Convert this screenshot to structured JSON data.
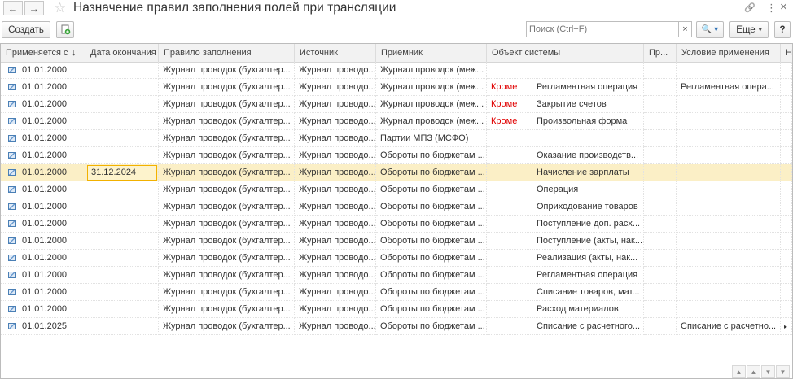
{
  "window": {
    "title": "Назначение правил заполнения полей при трансляции",
    "back_icon": "←",
    "forward_icon": "→",
    "star_icon": "☆",
    "link_icon": "🔗",
    "more_icon": "⋮",
    "close_icon": "×"
  },
  "toolbar": {
    "create_label": "Создать",
    "search_placeholder": "Поиск (Ctrl+F)",
    "clear_icon": "×",
    "search_button_icon": "🔍 ▾",
    "more_label": "Еще",
    "more_arrow": "▾",
    "help_label": "?"
  },
  "table": {
    "headers": [
      "Применяется с",
      "Дата окончания",
      "Правило заполнения",
      "Источник",
      "Приемник",
      "Объект системы",
      "Пр...",
      "Условие применения",
      "Н"
    ],
    "sort_indicator": "↓",
    "rows": [
      {
        "start": "01.01.2000",
        "end": "",
        "rule": "Журнал проводок (бухгалтер...",
        "source": "Журнал проводо...",
        "dest": "Журнал проводок (меж...",
        "except": "",
        "object": "",
        "pr": "",
        "condition": ""
      },
      {
        "start": "01.01.2000",
        "end": "",
        "rule": "Журнал проводок (бухгалтер...",
        "source": "Журнал проводо...",
        "dest": "Журнал проводок (меж...",
        "except": "Кроме",
        "object": "Регламентная операция",
        "pr": "",
        "condition": "Регламентная опера..."
      },
      {
        "start": "01.01.2000",
        "end": "",
        "rule": "Журнал проводок (бухгалтер...",
        "source": "Журнал проводо...",
        "dest": "Журнал проводок (меж...",
        "except": "Кроме",
        "object": "Закрытие счетов",
        "pr": "",
        "condition": ""
      },
      {
        "start": "01.01.2000",
        "end": "",
        "rule": "Журнал проводок (бухгалтер...",
        "source": "Журнал проводо...",
        "dest": "Журнал проводок (меж...",
        "except": "Кроме",
        "object": "Произвольная форма",
        "pr": "",
        "condition": ""
      },
      {
        "start": "01.01.2000",
        "end": "",
        "rule": "Журнал проводок (бухгалтер...",
        "source": "Журнал проводо...",
        "dest": "Партии МПЗ (МСФО)",
        "except": "",
        "object": "",
        "pr": "",
        "condition": ""
      },
      {
        "start": "01.01.2000",
        "end": "",
        "rule": "Журнал проводок (бухгалтер...",
        "source": "Журнал проводо...",
        "dest": "Обороты по бюджетам ...",
        "except": "",
        "object": "Оказание производств...",
        "pr": "",
        "condition": ""
      },
      {
        "start": "01.01.2000",
        "end": "31.12.2024",
        "rule": "Журнал проводок (бухгалтер...",
        "source": "Журнал проводо...",
        "dest": "Обороты по бюджетам ...",
        "except": "",
        "object": "Начисление зарплаты",
        "pr": "",
        "condition": ""
      },
      {
        "start": "01.01.2000",
        "end": "",
        "rule": "Журнал проводок (бухгалтер...",
        "source": "Журнал проводо...",
        "dest": "Обороты по бюджетам ...",
        "except": "",
        "object": "Операция",
        "pr": "",
        "condition": ""
      },
      {
        "start": "01.01.2000",
        "end": "",
        "rule": "Журнал проводок (бухгалтер...",
        "source": "Журнал проводо...",
        "dest": "Обороты по бюджетам ...",
        "except": "",
        "object": "Оприходование товаров",
        "pr": "",
        "condition": ""
      },
      {
        "start": "01.01.2000",
        "end": "",
        "rule": "Журнал проводок (бухгалтер...",
        "source": "Журнал проводо...",
        "dest": "Обороты по бюджетам ...",
        "except": "",
        "object": "Поступление доп. расх...",
        "pr": "",
        "condition": ""
      },
      {
        "start": "01.01.2000",
        "end": "",
        "rule": "Журнал проводок (бухгалтер...",
        "source": "Журнал проводо...",
        "dest": "Обороты по бюджетам ...",
        "except": "",
        "object": "Поступление (акты, нак...",
        "pr": "",
        "condition": ""
      },
      {
        "start": "01.01.2000",
        "end": "",
        "rule": "Журнал проводок (бухгалтер...",
        "source": "Журнал проводо...",
        "dest": "Обороты по бюджетам ...",
        "except": "",
        "object": "Реализация (акты, нак...",
        "pr": "",
        "condition": ""
      },
      {
        "start": "01.01.2000",
        "end": "",
        "rule": "Журнал проводок (бухгалтер...",
        "source": "Журнал проводо...",
        "dest": "Обороты по бюджетам ...",
        "except": "",
        "object": "Регламентная операция",
        "pr": "",
        "condition": ""
      },
      {
        "start": "01.01.2000",
        "end": "",
        "rule": "Журнал проводок (бухгалтер...",
        "source": "Журнал проводо...",
        "dest": "Обороты по бюджетам ...",
        "except": "",
        "object": "Списание товаров, мат...",
        "pr": "",
        "condition": ""
      },
      {
        "start": "01.01.2000",
        "end": "",
        "rule": "Журнал проводок (бухгалтер...",
        "source": "Журнал проводо...",
        "dest": "Обороты по бюджетам ...",
        "except": "",
        "object": "Расход материалов",
        "pr": "",
        "condition": ""
      },
      {
        "start": "01.01.2025",
        "end": "",
        "rule": "Журнал проводок (бухгалтер...",
        "source": "Журнал проводо...",
        "dest": "Обороты по бюджетам ...",
        "except": "",
        "object": "Списание с расчетного...",
        "pr": "",
        "condition": "Списание с расчетно..."
      }
    ],
    "selected_row": 6,
    "last_row_arrow": "▸",
    "scroll_icons": [
      "▲",
      "▲",
      "▼",
      "▼"
    ]
  }
}
